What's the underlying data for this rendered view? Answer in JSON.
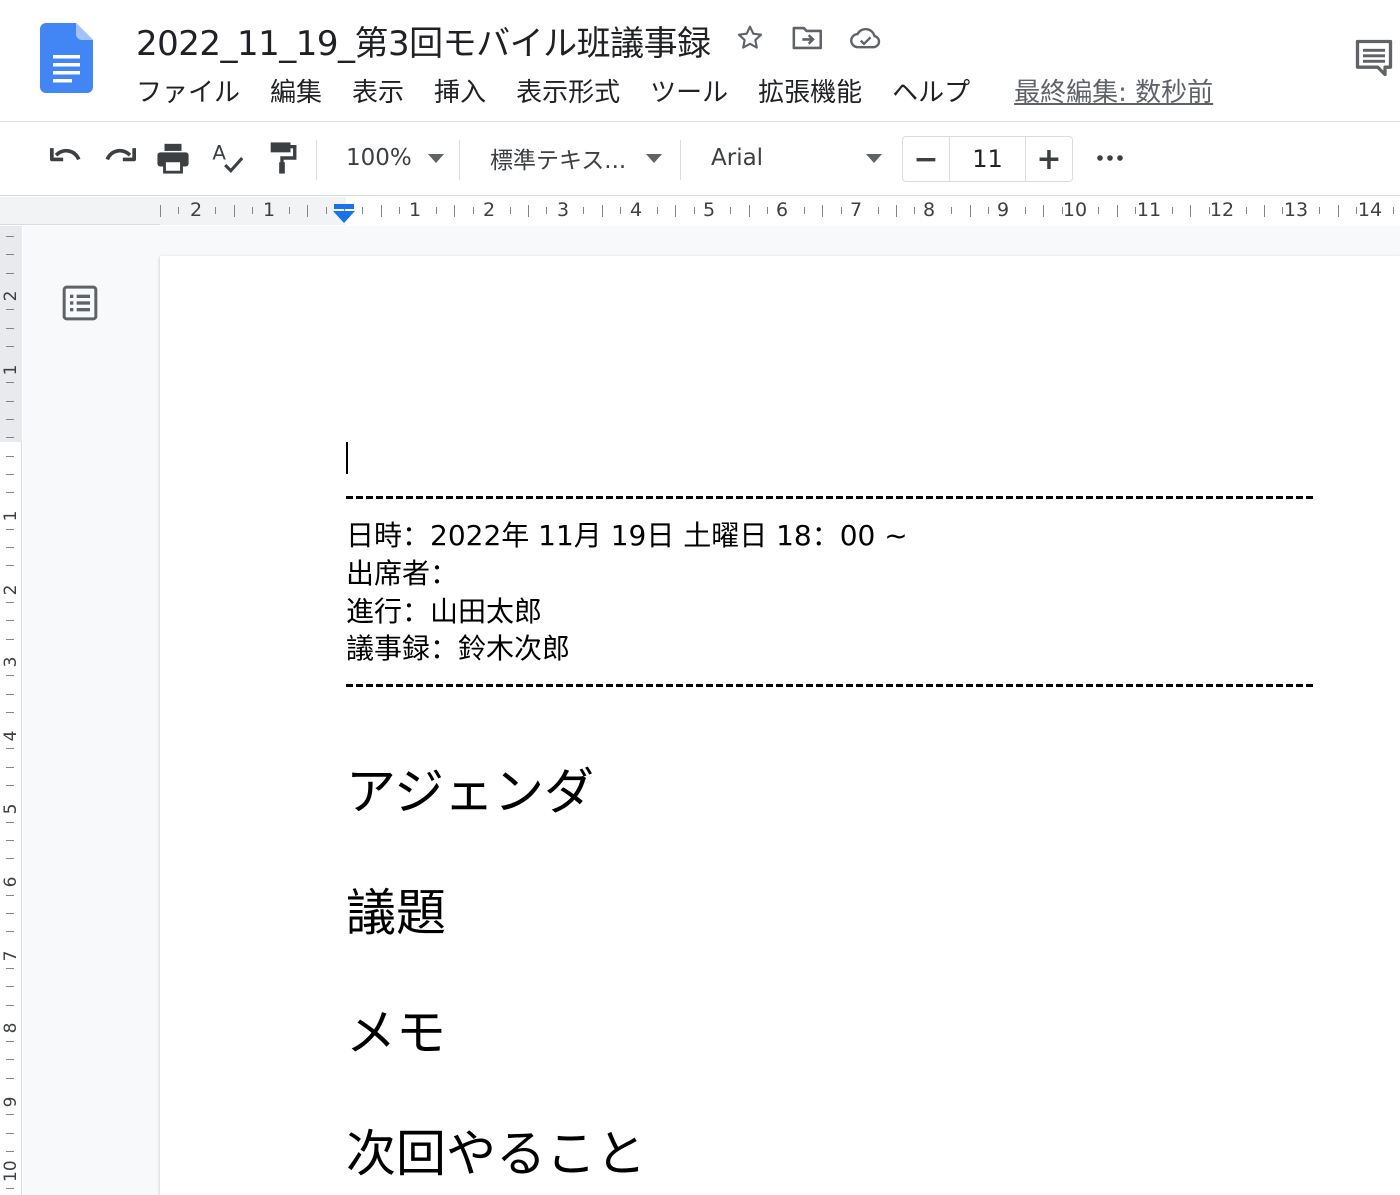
{
  "doc": {
    "title": "2022_11_19_第3回モバイル班議事録",
    "last_edit": "最終編集: 数秒前"
  },
  "menu": [
    "ファイル",
    "編集",
    "表示",
    "挿入",
    "表示形式",
    "ツール",
    "拡張機能",
    "ヘルプ"
  ],
  "toolbar": {
    "zoom": "100%",
    "style": "標準テキス...",
    "font": "Arial",
    "font_size": "11",
    "minus": "−",
    "plus": "+"
  },
  "ruler": {
    "h_labels": [
      "2",
      "1",
      "1",
      "2",
      "3",
      "4",
      "5",
      "6",
      "7",
      "8",
      "9",
      "10",
      "11",
      "12",
      "13",
      "14"
    ],
    "v_labels": [
      "2",
      "1",
      "1",
      "2",
      "3",
      "4",
      "5",
      "6",
      "7",
      "8",
      "9",
      "10"
    ]
  },
  "content": {
    "dashes_line": "------------------------------------------------------------------------------------------------------",
    "datetime": "日時：2022年 11月 19日 土曜日 18：00 ~",
    "attendees": "出席者：",
    "facilitator": "進行：山田太郎",
    "minutes_taker": "議事録：鈴木次郎",
    "headings": [
      "アジェンダ",
      "議題",
      "メモ",
      "次回やること"
    ]
  },
  "colors": {
    "docs_blue": "#4285f4",
    "icon_gray": "#5f6368",
    "indent_blue": "#1a73e8"
  }
}
